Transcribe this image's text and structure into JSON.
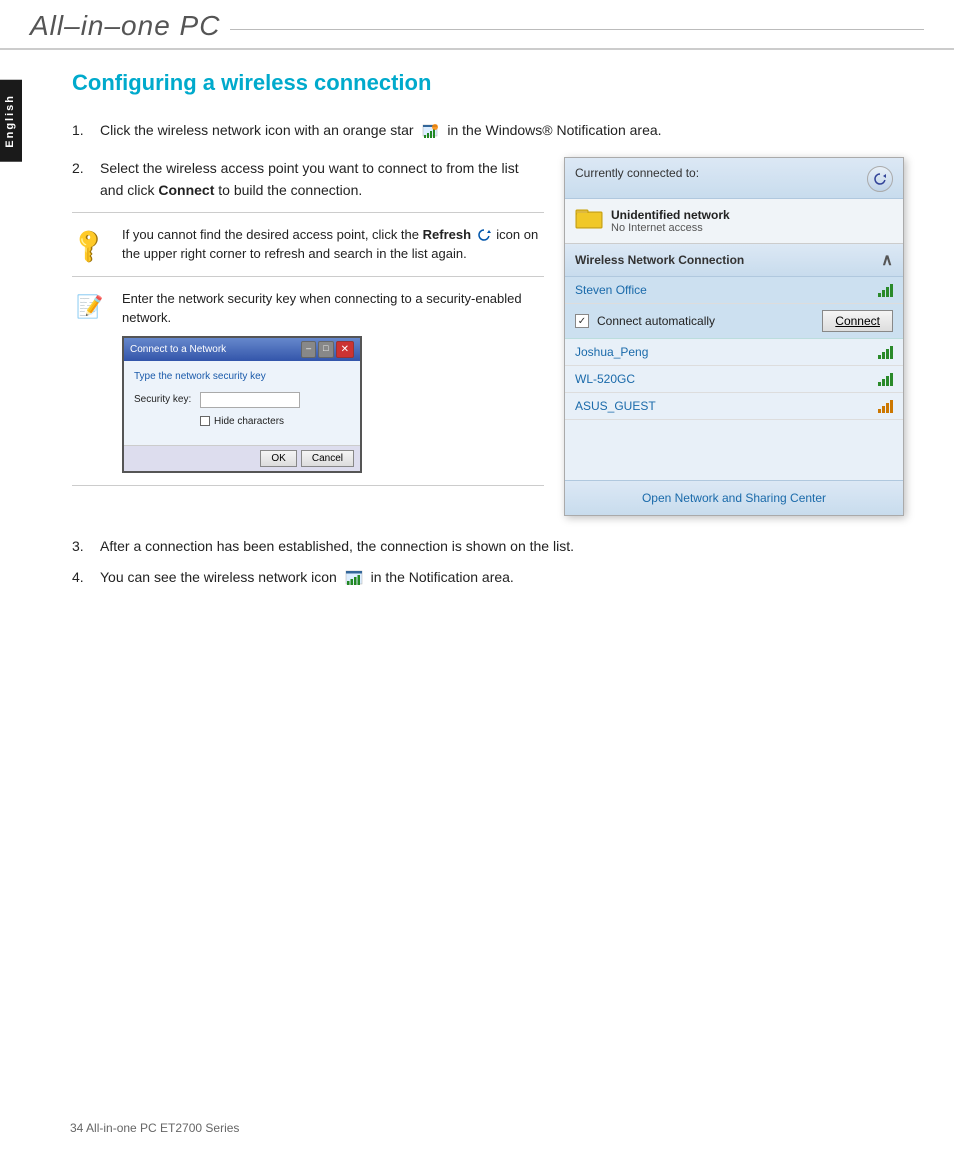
{
  "header": {
    "title": "All–in–one PC",
    "line_decoration": true
  },
  "sidebar": {
    "label": "English"
  },
  "page": {
    "title": "Configuring a wireless connection",
    "steps": [
      {
        "number": "1.",
        "text": "Click the wireless network icon with an orange star",
        "text_suffix": "in the Windows® Notification area."
      },
      {
        "number": "2.",
        "text": "Select the wireless access point you want to connect to from the list and click ",
        "bold": "Connect",
        "text_suffix": " to build the connection."
      },
      {
        "number": "3.",
        "text": "After a connection has been established, the connection is shown on the list."
      },
      {
        "number": "4.",
        "text": "You can see the wireless network icon",
        "text_suffix": "in the Notification area."
      }
    ],
    "notes": [
      {
        "type": "tip",
        "text": "If you cannot find the desired access point, click the ",
        "bold": "Refresh",
        "text_suffix": " icon  on the upper right corner to refresh and search in the list again."
      },
      {
        "type": "note",
        "text": "Enter the network security key when connecting to a security-enabled network."
      }
    ],
    "network_panel": {
      "header": "Currently connected to:",
      "unidentified_network": "Unidentified network",
      "no_internet": "No Internet access",
      "section": "Wireless Network Connection",
      "networks": [
        {
          "name": "Steven Office",
          "selected": true
        },
        {
          "name": "Joshua_Peng",
          "selected": false
        },
        {
          "name": "WL-520GC",
          "selected": false
        },
        {
          "name": "ASUS_GUEST",
          "selected": false,
          "orange": true
        }
      ],
      "connect_automatically_label": "Connect automatically",
      "connect_button": "Connect",
      "footer_link": "Open Network and Sharing Center"
    },
    "security_dialog": {
      "title": "Connect to a Network",
      "close_btn": "✕",
      "prompt": "Type the network security key",
      "field_label": "Security key:",
      "checkbox_label": "Hide characters",
      "ok_btn": "OK",
      "cancel_btn": "Cancel"
    },
    "footer": "34    All-in-one PC ET2700 Series"
  }
}
